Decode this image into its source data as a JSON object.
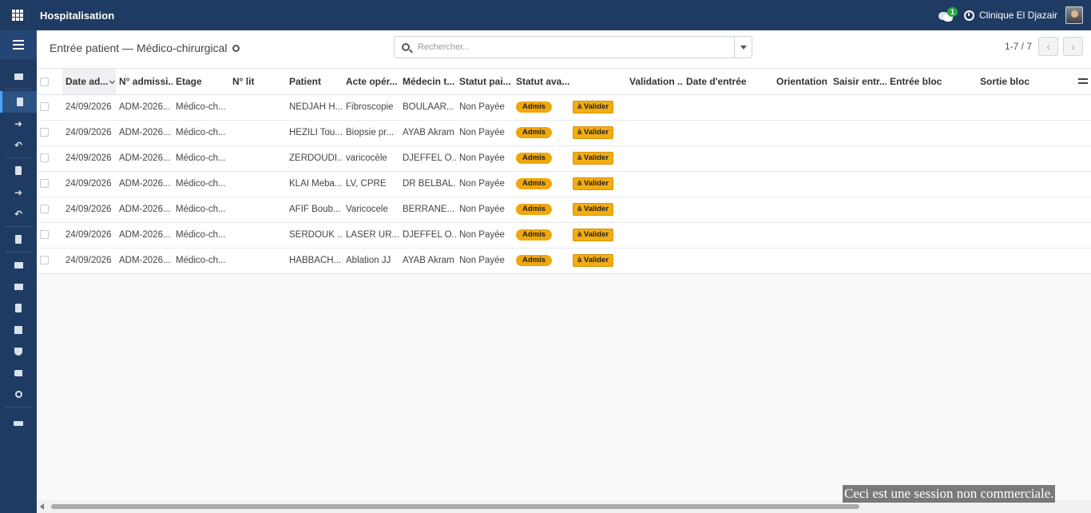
{
  "topbar": {
    "app_title": "Hospitalisation",
    "chat_count": "1",
    "company": "Clinique El Djazair"
  },
  "control": {
    "breadcrumb": "Entrée patient — Médico-chirurgical",
    "search_placeholder": "Rechercher...",
    "pager_value": "1-7 / 7",
    "pager_prev": "‹",
    "pager_next": "›"
  },
  "table": {
    "headers": [
      "Date ad...",
      "N° admissi...",
      "Etage",
      "N° lit",
      "Patient",
      "Acte opér...",
      "Médecin t...",
      "Statut pai...",
      "Statut ava...",
      "",
      "Validation ...",
      "Date d'entrée",
      "Orientation",
      "Saisir entr...",
      "Entrée bloc",
      "Sortie bloc"
    ],
    "rows": [
      {
        "date": "24/09/2026",
        "admission": "ADM-2026...",
        "etage": "Médico-ch...",
        "lit": "",
        "patient": "NEDJAH H...",
        "acte": "Fibroscopie",
        "medecin": "BOULAAR...",
        "paiement": "Non Payée",
        "statut": "Admis",
        "validation": "à Valider"
      },
      {
        "date": "24/09/2026",
        "admission": "ADM-2026...",
        "etage": "Médico-ch...",
        "lit": "",
        "patient": "HEZILI Tou...",
        "acte": "Biopsie pr...",
        "medecin": "AYAB Akram",
        "paiement": "Non Payée",
        "statut": "Admis",
        "validation": "à Valider"
      },
      {
        "date": "24/09/2026",
        "admission": "ADM-2026...",
        "etage": "Médico-ch...",
        "lit": "",
        "patient": "ZERDOUDI...",
        "acte": "varicocèle",
        "medecin": "DJEFFEL O...",
        "paiement": "Non Payée",
        "statut": "Admis",
        "validation": "à Valider"
      },
      {
        "date": "24/09/2026",
        "admission": "ADM-2026...",
        "etage": "Médico-ch...",
        "lit": "",
        "patient": "KLAI Meba...",
        "acte": "LV, CPRE",
        "medecin": "DR BELBAL...",
        "paiement": "Non Payée",
        "statut": "Admis",
        "validation": "à Valider"
      },
      {
        "date": "24/09/2026",
        "admission": "ADM-2026...",
        "etage": "Médico-ch...",
        "lit": "",
        "patient": "AFIF Boub...",
        "acte": "Varicocele",
        "medecin": "BERRANE...",
        "paiement": "Non Payée",
        "statut": "Admis",
        "validation": "à Valider"
      },
      {
        "date": "24/09/2026",
        "admission": "ADM-2026...",
        "etage": "Médico-ch...",
        "lit": "",
        "patient": "SERDOUK ...",
        "acte": "LASER UR...",
        "medecin": "DJEFFEL O...",
        "paiement": "Non Payée",
        "statut": "Admis",
        "validation": "à Valider"
      },
      {
        "date": "24/09/2026",
        "admission": "ADM-2026...",
        "etage": "Médico-ch...",
        "lit": "",
        "patient": "HABBACH...",
        "acte": "Ablation JJ",
        "medecin": "AYAB Akram",
        "paiement": "Non Payée",
        "statut": "Admis",
        "validation": "à Valider"
      }
    ]
  },
  "watermark": "Ceci est une session non commerciale.",
  "colors": {
    "topbar": "#1f3b63",
    "badge": "#f0a70c"
  }
}
